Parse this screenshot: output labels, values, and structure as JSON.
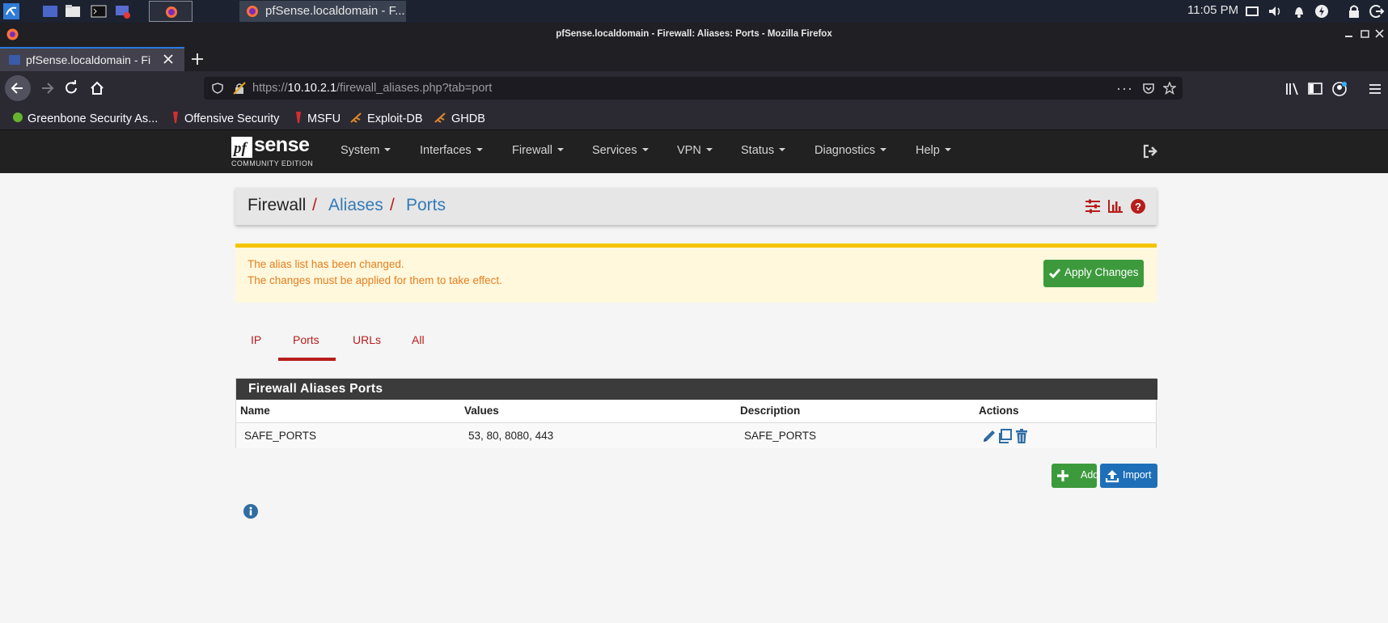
{
  "taskbar": {
    "window_label": "pfSense.localdomain - F...",
    "clock": "11:05 PM"
  },
  "browser": {
    "window_title": "pfSense.localdomain - Firewall: Aliases: Ports - Mozilla Firefox",
    "tab_title": "pfSense.localdomain - Fi",
    "url_scheme": "https://",
    "url_host": "10.10.2.1",
    "url_path": "/firewall_aliases.php?tab=port",
    "bookmarks": [
      {
        "label": "Greenbone Security As..."
      },
      {
        "label": "Offensive Security"
      },
      {
        "label": "MSFU"
      },
      {
        "label": "Exploit-DB"
      },
      {
        "label": "GHDB"
      }
    ]
  },
  "pfsense": {
    "logo_main": "sense",
    "logo_sub": "COMMUNITY EDITION",
    "menu": [
      {
        "label": "System"
      },
      {
        "label": "Interfaces"
      },
      {
        "label": "Firewall"
      },
      {
        "label": "Services"
      },
      {
        "label": "VPN"
      },
      {
        "label": "Status"
      },
      {
        "label": "Diagnostics"
      },
      {
        "label": "Help"
      }
    ]
  },
  "breadcrumb": {
    "level1": "Firewall",
    "level2": "Aliases",
    "level3": "Ports",
    "sep": "/"
  },
  "alert": {
    "line1": "The alias list has been changed.",
    "line2": "The changes must be applied for them to take effect.",
    "apply_label": "Apply Changes"
  },
  "tabs": [
    {
      "label": "IP"
    },
    {
      "label": "Ports",
      "active": true
    },
    {
      "label": "URLs"
    },
    {
      "label": "All"
    }
  ],
  "table": {
    "title": "Firewall Aliases Ports",
    "columns": [
      "Name",
      "Values",
      "Description",
      "Actions"
    ],
    "rows": [
      {
        "name": "SAFE_PORTS",
        "values": "53, 80, 8080, 443",
        "description": "SAFE_PORTS"
      }
    ]
  },
  "buttons": {
    "add_label": "Add",
    "import_label": "Import"
  },
  "colors": {
    "accent_red": "#b71c1c",
    "link_blue": "#337ab7",
    "success_green": "#3c9a3c",
    "primary_blue": "#1e6fb8"
  }
}
